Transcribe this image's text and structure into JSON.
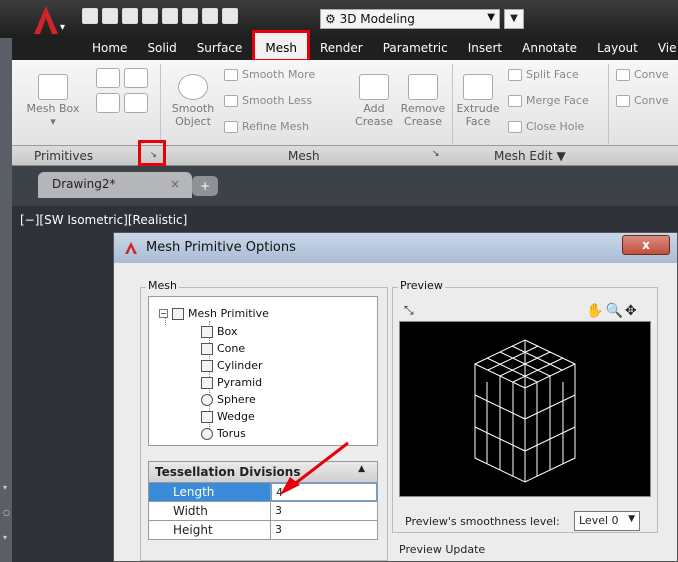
{
  "workspace": "3D Modeling",
  "tabs": [
    "Home",
    "Solid",
    "Surface",
    "Mesh",
    "Render",
    "Parametric",
    "Insert",
    "Annotate",
    "Layout",
    "Vie"
  ],
  "active_tab": "Mesh",
  "ribbon": {
    "mesh_box": "Mesh Box",
    "smooth_object": [
      "Smooth",
      "Object"
    ],
    "smooth_more": "Smooth More",
    "smooth_less": "Smooth Less",
    "refine_mesh": "Refine Mesh",
    "add_crease": [
      "Add",
      "Crease"
    ],
    "remove_crease": [
      "Remove",
      "Crease"
    ],
    "extrude_face": [
      "Extrude",
      "Face"
    ],
    "split_face": "Split Face",
    "merge_face": "Merge Face",
    "close_hole": "Close Hole",
    "convert1": "Conve",
    "convert2": "Conve"
  },
  "panels": {
    "primitives": "Primitives",
    "mesh": "Mesh",
    "mesh_edit": "Mesh Edit ▼"
  },
  "document_tab": "Drawing2*",
  "viewport_label": "[−][SW Isometric][Realistic]",
  "dialog": {
    "title": "Mesh Primitive Options",
    "close": "x",
    "mesh_group": "Mesh",
    "preview_group": "Preview",
    "tree_root": "Mesh Primitive",
    "tree_items": [
      "Box",
      "Cone",
      "Cylinder",
      "Pyramid",
      "Sphere",
      "Wedge",
      "Torus"
    ],
    "tess_header": "Tessellation Divisions",
    "properties": [
      {
        "key": "Length",
        "value": "4"
      },
      {
        "key": "Width",
        "value": "3"
      },
      {
        "key": "Height",
        "value": "3"
      }
    ],
    "smoothness_label": "Preview's smoothness level:",
    "smoothness_value": "Level 0",
    "preview_update": "Preview Update"
  },
  "colors": {
    "highlight": "#e8000b",
    "selection": "#3a8bd9"
  }
}
